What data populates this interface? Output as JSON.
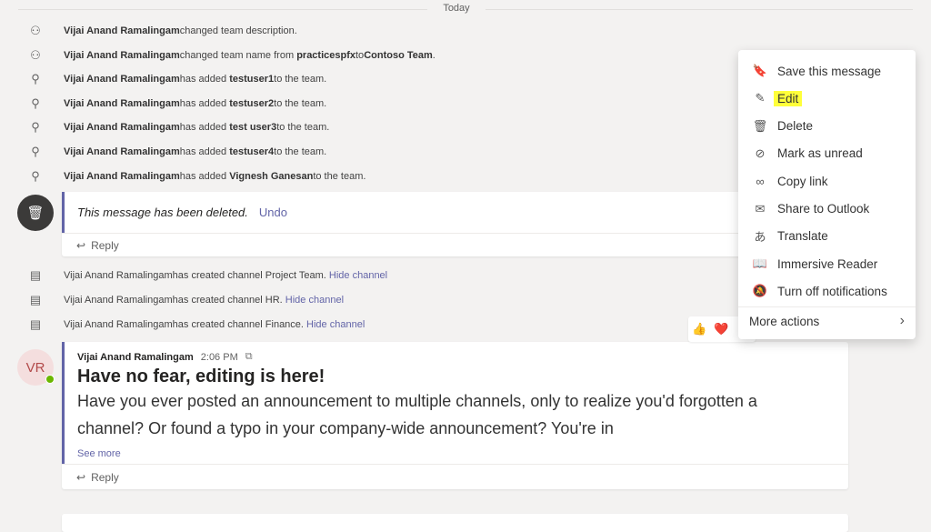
{
  "date_label": "Today",
  "system_messages": [
    {
      "icon": "team-icon",
      "actor": "Vijai Anand Ramalingam",
      "pre": " changed team description.",
      "b1": "",
      "mid": "",
      "b2": "",
      "post": ""
    },
    {
      "icon": "team-icon",
      "actor": "Vijai Anand Ramalingam",
      "pre": " changed team name from ",
      "b1": "practicespfx",
      "mid": " to ",
      "b2": "Contoso Team",
      "post": "."
    },
    {
      "icon": "add-person-icon",
      "actor": "Vijai Anand Ramalingam",
      "pre": " has added ",
      "b1": "testuser1",
      "mid": " to the team.",
      "b2": "",
      "post": ""
    },
    {
      "icon": "add-person-icon",
      "actor": "Vijai Anand Ramalingam",
      "pre": " has added ",
      "b1": "testuser2",
      "mid": " to the team.",
      "b2": "",
      "post": ""
    },
    {
      "icon": "add-person-icon",
      "actor": "Vijai Anand Ramalingam",
      "pre": " has added ",
      "b1": "test user3",
      "mid": " to the team.",
      "b2": "",
      "post": ""
    },
    {
      "icon": "add-person-icon",
      "actor": "Vijai Anand Ramalingam",
      "pre": " has added ",
      "b1": "testuser4",
      "mid": " to the team.",
      "b2": "",
      "post": ""
    },
    {
      "icon": "add-person-icon",
      "actor": "Vijai Anand Ramalingam",
      "pre": " has added ",
      "b1": "Vignesh Ganesan",
      "mid": " to the team.",
      "b2": "",
      "post": ""
    }
  ],
  "deleted": {
    "text": "This message has been deleted.",
    "undo": "Undo",
    "reply": "Reply"
  },
  "channel_messages": [
    {
      "actor": "Vijai Anand Ramalingam",
      "text": " has created channel Project Team.",
      "link": "Hide channel"
    },
    {
      "actor": "Vijai Anand Ramalingam",
      "text": " has created channel HR.",
      "link": "Hide channel"
    },
    {
      "actor": "Vijai Anand Ramalingam",
      "text": " has created channel Finance.",
      "link": "Hide channel"
    }
  ],
  "post": {
    "avatar": "VR",
    "author": "Vijai Anand Ramalingam",
    "time": "2:06 PM",
    "title": "Have no fear, editing is here!",
    "body": "Have you ever posted an announcement to multiple channels, only to realize you'd forgotten a channel? Or found a typo in your company-wide announcement? You're in",
    "see_more": "See more",
    "reply": "Reply"
  },
  "reactions": [
    "👍",
    "❤️"
  ],
  "menu": {
    "items": [
      {
        "icon": "bookmark-icon",
        "label": "Save this message"
      },
      {
        "icon": "pencil-icon",
        "label": "Edit"
      },
      {
        "icon": "trash-icon",
        "label": "Delete"
      },
      {
        "icon": "unread-icon",
        "label": "Mark as unread"
      },
      {
        "icon": "link-icon",
        "label": "Copy link"
      },
      {
        "icon": "mail-icon",
        "label": "Share to Outlook"
      },
      {
        "icon": "translate-icon",
        "label": "Translate"
      },
      {
        "icon": "immersive-reader-icon",
        "label": "Immersive Reader"
      },
      {
        "icon": "bell-off-icon",
        "label": "Turn off notifications"
      }
    ],
    "more": "More actions"
  },
  "colors": {
    "accent": "#6264a7",
    "highlight": "#ffff3a",
    "presence": "#6bb700"
  }
}
